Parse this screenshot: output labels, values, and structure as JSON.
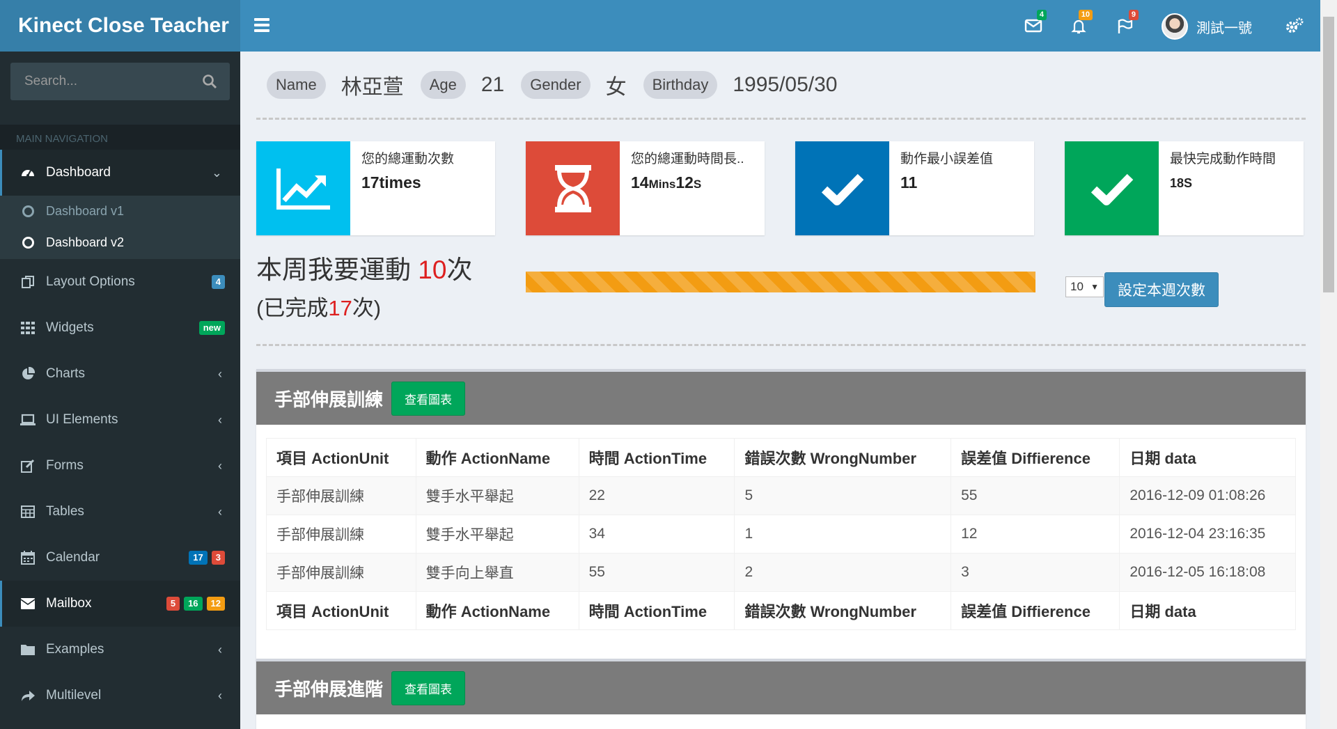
{
  "app": {
    "logo": "Kinect Close Teacher"
  },
  "navbar": {
    "mail_count": "4",
    "notification_count": "10",
    "flag_count": "9",
    "user_name": "測試一號",
    "colors": {
      "mail_badge": "#00a65a",
      "notification_badge": "#f39c12",
      "flag_badge": "#dd4b39"
    }
  },
  "sidebar": {
    "search_placeholder": "Search...",
    "header": "MAIN NAVIGATION",
    "items": [
      {
        "label": "Dashboard",
        "icon": "dashboard-icon"
      },
      {
        "label": "Layout Options",
        "icon": "files-icon",
        "badges": [
          "4"
        ]
      },
      {
        "label": "Widgets",
        "icon": "grid-icon",
        "badges": [
          "new"
        ]
      },
      {
        "label": "Charts",
        "icon": "pie-chart-icon"
      },
      {
        "label": "UI Elements",
        "icon": "laptop-icon"
      },
      {
        "label": "Forms",
        "icon": "edit-icon"
      },
      {
        "label": "Tables",
        "icon": "table-icon"
      },
      {
        "label": "Calendar",
        "icon": "calendar-icon",
        "badges": [
          "17",
          "3"
        ]
      },
      {
        "label": "Mailbox",
        "icon": "envelope-icon",
        "badges": [
          "5",
          "16",
          "12"
        ]
      },
      {
        "label": "Examples",
        "icon": "folder-icon"
      },
      {
        "label": "Multilevel",
        "icon": "share-icon"
      }
    ],
    "dashboard_sub": [
      "Dashboard v1",
      "Dashboard v2"
    ]
  },
  "profile": {
    "name_label": "Name",
    "name": "林亞萱",
    "age_label": "Age",
    "age": "21",
    "gender_label": "Gender",
    "gender": "女",
    "birthday_label": "Birthday",
    "birthday": "1995/05/30"
  },
  "stats": [
    {
      "label": "您的總運動次數",
      "value_num": "17",
      "value_unit": "times",
      "color": "#00c0ef",
      "icon": "line-chart-icon"
    },
    {
      "label": "您的總運動時間長..",
      "value_num": "14",
      "value_unit": "Mins",
      "value_num2": "12",
      "value_unit2": "S",
      "color": "#dd4b39",
      "icon": "hourglass-icon"
    },
    {
      "label": "動作最小誤差值",
      "value_num": "11",
      "color": "#0073b7",
      "icon": "check-icon"
    },
    {
      "label": "最快完成動作時間",
      "value_num": "18",
      "value_unit": "S",
      "color": "#00a65a",
      "icon": "check-icon"
    }
  ],
  "goal": {
    "prefix": "本周我要運動 ",
    "target": "10",
    "suffix": "次",
    "done_prefix": "(已完成",
    "done": "17",
    "done_suffix": "次)",
    "progress_fraction": 1.0,
    "select_value": "10",
    "button_label": "設定本週次數"
  },
  "panels": [
    {
      "title": "手部伸展訓練",
      "chart_button": "查看圖表",
      "columns": [
        "項目 ActionUnit",
        "動作 ActionName",
        "時間 ActionTime",
        "錯誤次數 WrongNumber",
        "誤差值 Diffierence",
        "日期 data"
      ],
      "rows": [
        [
          "手部伸展訓練",
          "雙手水平舉起",
          "22",
          "5",
          "55",
          "2016-12-09 01:08:26"
        ],
        [
          "手部伸展訓練",
          "雙手水平舉起",
          "34",
          "1",
          "12",
          "2016-12-04 23:16:35"
        ],
        [
          "手部伸展訓練",
          "雙手向上舉直",
          "55",
          "2",
          "3",
          "2016-12-05 16:18:08"
        ]
      ]
    },
    {
      "title": "手部伸展進階",
      "chart_button": "查看圖表"
    }
  ]
}
